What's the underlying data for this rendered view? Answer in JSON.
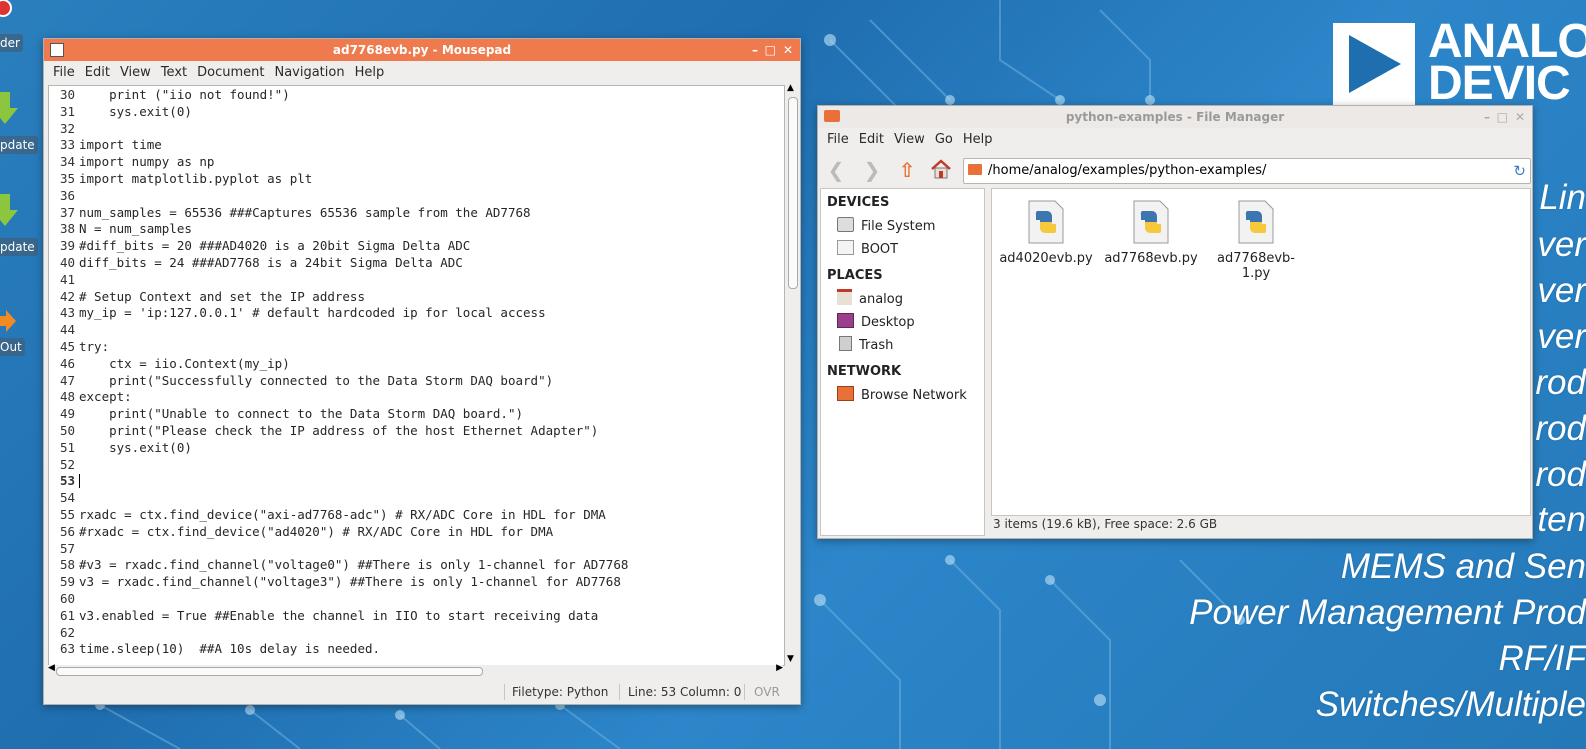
{
  "desktop": {
    "icons": [
      {
        "label": "der"
      },
      {
        "label": "pdate"
      },
      {
        "label": "pdate"
      },
      {
        "label": "Out"
      }
    ],
    "brand": {
      "line1": "ANALO",
      "line2": "DEVIC"
    },
    "product_lines": [
      "Lin",
      "ver",
      "ver",
      "ver",
      "rod",
      "rod",
      "rod",
      "ten",
      "MEMS and Sen",
      "Power Management Prod",
      "RF/IF",
      "Switches/Multiple"
    ]
  },
  "mousepad": {
    "title": "ad7768evb.py - Mousepad",
    "menu": [
      "File",
      "Edit",
      "View",
      "Text",
      "Document",
      "Navigation",
      "Help"
    ],
    "cursor_line": "53",
    "lines": [
      {
        "n": "30",
        "t": "    print (\"iio not found!\")"
      },
      {
        "n": "31",
        "t": "    sys.exit(0)"
      },
      {
        "n": "32",
        "t": ""
      },
      {
        "n": "33",
        "t": "import time"
      },
      {
        "n": "34",
        "t": "import numpy as np"
      },
      {
        "n": "35",
        "t": "import matplotlib.pyplot as plt"
      },
      {
        "n": "36",
        "t": ""
      },
      {
        "n": "37",
        "t": "num_samples = 65536 ###Captures 65536 sample from the AD7768"
      },
      {
        "n": "38",
        "t": "N = num_samples"
      },
      {
        "n": "39",
        "t": "#diff_bits = 20 ###AD4020 is a 20bit Sigma Delta ADC"
      },
      {
        "n": "40",
        "t": "diff_bits = 24 ###AD7768 is a 24bit Sigma Delta ADC"
      },
      {
        "n": "41",
        "t": ""
      },
      {
        "n": "42",
        "t": "# Setup Context and set the IP address"
      },
      {
        "n": "43",
        "t": "my_ip = 'ip:127.0.0.1' # default hardcoded ip for local access"
      },
      {
        "n": "44",
        "t": ""
      },
      {
        "n": "45",
        "t": "try:"
      },
      {
        "n": "46",
        "t": "    ctx = iio.Context(my_ip)"
      },
      {
        "n": "47",
        "t": "    print(\"Successfully connected to the Data Storm DAQ board\")"
      },
      {
        "n": "48",
        "t": "except:"
      },
      {
        "n": "49",
        "t": "    print(\"Unable to connect to the Data Storm DAQ board.\")"
      },
      {
        "n": "50",
        "t": "    print(\"Please check the IP address of the host Ethernet Adapter\")"
      },
      {
        "n": "51",
        "t": "    sys.exit(0)"
      },
      {
        "n": "52",
        "t": ""
      },
      {
        "n": "53",
        "t": ""
      },
      {
        "n": "54",
        "t": ""
      },
      {
        "n": "55",
        "t": "rxadc = ctx.find_device(\"axi-ad7768-adc\") # RX/ADC Core in HDL for DMA"
      },
      {
        "n": "56",
        "t": "#rxadc = ctx.find_device(\"ad4020\") # RX/ADC Core in HDL for DMA"
      },
      {
        "n": "57",
        "t": ""
      },
      {
        "n": "58",
        "t": "#v3 = rxadc.find_channel(\"voltage0\") ##There is only 1-channel for AD7768"
      },
      {
        "n": "59",
        "t": "v3 = rxadc.find_channel(\"voltage3\") ##There is only 1-channel for AD7768"
      },
      {
        "n": "60",
        "t": ""
      },
      {
        "n": "61",
        "t": "v3.enabled = True ##Enable the channel in IIO to start receiving data"
      },
      {
        "n": "62",
        "t": ""
      },
      {
        "n": "63",
        "t": "time.sleep(10)  ##A 10s delay is needed."
      }
    ],
    "status": {
      "filetype": "Filetype: Python",
      "position": "Line: 53 Column: 0",
      "mode": "OVR"
    }
  },
  "filemanager": {
    "title": "python-examples - File Manager",
    "menu": [
      "File",
      "Edit",
      "View",
      "Go",
      "Help"
    ],
    "path": "/home/analog/examples/python-examples/",
    "sections": {
      "devices": "DEVICES",
      "places": "PLACES",
      "network": "NETWORK"
    },
    "devices": [
      "File System",
      "BOOT"
    ],
    "places": [
      "analog",
      "Desktop",
      "Trash"
    ],
    "network": [
      "Browse Network"
    ],
    "files": [
      "ad4020evb.py",
      "ad7768evb.py",
      "ad7768evb-1.py"
    ],
    "status": "3 items (19.6 kB), Free space: 2.6 GB"
  },
  "colors": {
    "mousepad_title": "#ef7a4d",
    "desktop": "#2478b8"
  }
}
